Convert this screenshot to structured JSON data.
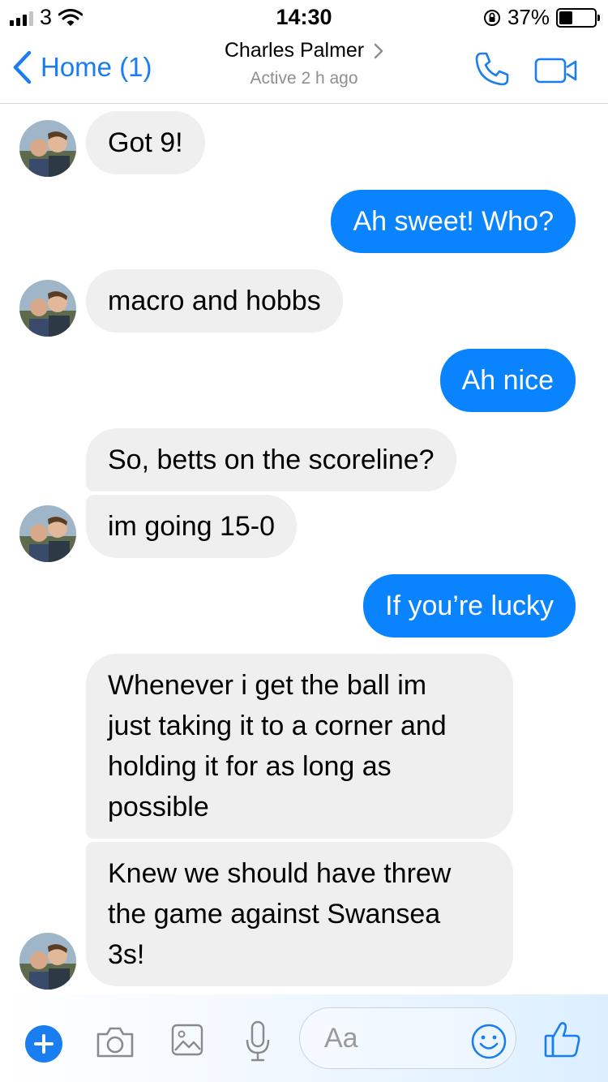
{
  "status_bar": {
    "carrier": "3",
    "time": "14:30",
    "battery": "37%",
    "battery_level": 0.37
  },
  "nav": {
    "back_label": "Home (1)",
    "contact_name": "Charles Palmer",
    "contact_status": "Active 2 h ago",
    "icons": [
      "chevron-left-icon",
      "chevron-right-icon",
      "phone-icon",
      "video-camera-icon"
    ]
  },
  "messages": [
    {
      "from": "them",
      "text": "Got 9!"
    },
    {
      "from": "me",
      "text": "Ah sweet! Who?"
    },
    {
      "from": "them",
      "text": "macro and hobbs"
    },
    {
      "from": "me",
      "text": "Ah nice"
    },
    {
      "from": "them",
      "text": "So, betts on the scoreline?"
    },
    {
      "from": "them",
      "text": "im going 15-0"
    },
    {
      "from": "me",
      "text": "If you’re lucky"
    },
    {
      "from": "them",
      "lines": [
        "Whenever i get the ball im",
        "just taking it to a corner and",
        "holding it for as long as",
        "possible"
      ]
    },
    {
      "from": "them",
      "lines": [
        "Knew we should have threw",
        "the game against Swansea",
        "3s!"
      ]
    }
  ],
  "composer": {
    "placeholder": "Aa",
    "icons": [
      "plus-icon",
      "camera-icon",
      "image-icon",
      "microphone-icon",
      "smiley-icon",
      "thumbs-up-icon"
    ]
  },
  "colors": {
    "accent": "#1a7df0",
    "outgoing_bubble": "#0a83ff",
    "incoming_bubble": "#efefef",
    "secondary_text": "#8e8e93"
  }
}
